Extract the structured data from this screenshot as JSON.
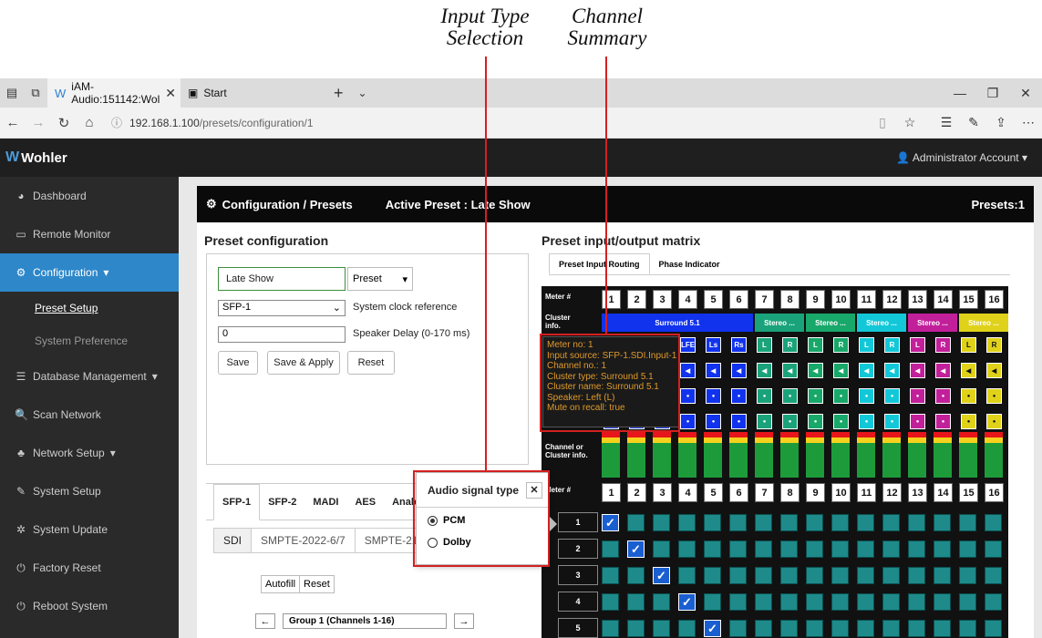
{
  "annotations": {
    "input_type": "Input Type\nSelection",
    "channel_summary": "Channel\nSummary"
  },
  "browser": {
    "tab_title": "iAM-Audio:151142:Wol",
    "tab2_title": "Start",
    "url_host": "192.168.1.100",
    "url_path": "/presets/configuration/1"
  },
  "app": {
    "logo": "Wohler",
    "account": "Administrator Account"
  },
  "sidebar": {
    "items": [
      {
        "icon": "dashboard-icon",
        "label": "Dashboard"
      },
      {
        "icon": "monitor-icon",
        "label": "Remote Monitor"
      },
      {
        "icon": "cogs-icon",
        "label": "Configuration"
      },
      {
        "label": "Preset Setup"
      },
      {
        "label": "System Preference"
      },
      {
        "icon": "database-icon",
        "label": "Database Management"
      },
      {
        "icon": "search-icon",
        "label": "Scan Network"
      },
      {
        "icon": "network-icon",
        "label": "Network Setup"
      },
      {
        "icon": "wrench-icon",
        "label": "System Setup"
      },
      {
        "icon": "gear-icon",
        "label": "System Update"
      },
      {
        "icon": "power-icon",
        "label": "Factory Reset"
      },
      {
        "icon": "power-icon",
        "label": "Reboot System"
      }
    ]
  },
  "header": {
    "title": "Configuration / Presets",
    "active_preset": "Active Preset : Late Show",
    "presets_count": "Presets:1"
  },
  "preset_config": {
    "title": "Preset configuration",
    "name_value": "Late Show",
    "preset_select": "Preset",
    "clock_value": "SFP-1",
    "clock_label": "System clock reference",
    "delay_value": "0",
    "delay_label": "Speaker Delay (0-170 ms)",
    "save": "Save",
    "save_apply": "Save & Apply",
    "reset": "Reset"
  },
  "input_tabs": {
    "tabs": [
      "SFP-1",
      "SFP-2",
      "MADI",
      "AES",
      "Analog"
    ],
    "subtabs": [
      "SDI",
      "SMPTE-2022-6/7",
      "SMPTE-2110"
    ],
    "autofill": "Autofill",
    "reset": "Reset",
    "group": "Group 1 (Channels 1-16)"
  },
  "matrix": {
    "title": "Preset input/output matrix",
    "tabs": [
      "Preset Input Routing",
      "Phase Indicator"
    ],
    "meter_label": "Meter #",
    "cluster_label": "Cluster info.",
    "channel_label": "Channel or Cluster info.",
    "meters": [
      "1",
      "2",
      "3",
      "4",
      "5",
      "6",
      "7",
      "8",
      "9",
      "10",
      "11",
      "12",
      "13",
      "14",
      "15",
      "16"
    ],
    "clusters": [
      "Surround 5.1",
      "Stereo ...",
      "Stereo ...",
      "Stereo ...",
      "Stereo ...",
      "Stereo ..."
    ],
    "row1_labels": [
      "L",
      "R",
      "C",
      "LFE",
      "Ls",
      "Rs",
      "L",
      "R",
      "L",
      "R",
      "L",
      "R",
      "L",
      "R",
      "L",
      "R"
    ],
    "routing_rows": [
      "1",
      "2",
      "3",
      "4",
      "5"
    ]
  },
  "tooltip": {
    "lines": [
      "Meter no: 1",
      "Input source: SFP-1.SDI.Input-1",
      "Channel no.: 1",
      "Cluster type: Surround 5.1",
      "Cluster name: Surround 5.1",
      "Speaker: Left (L)",
      "Mute on recall: true"
    ]
  },
  "popover": {
    "title": "Audio signal type",
    "options": [
      "PCM",
      "Dolby"
    ]
  },
  "colors": {
    "accent": "#2d87c9",
    "annotation": "#d42020",
    "surround": "#1133ee",
    "stereo_colors": [
      "#1aa37a",
      "#17a86a",
      "#12c8d8",
      "#c21f9a",
      "#e0d21a"
    ]
  }
}
